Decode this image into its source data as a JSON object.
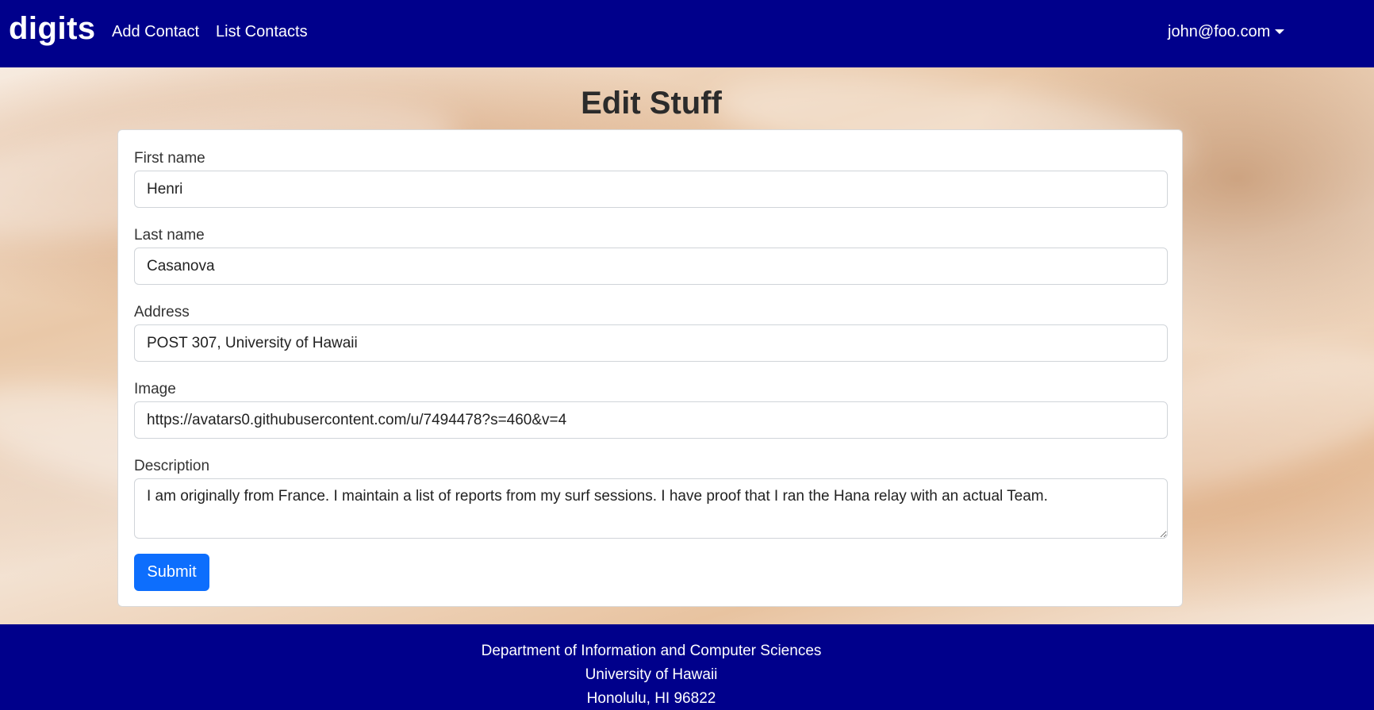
{
  "navbar": {
    "brand": "digits",
    "links": {
      "add_contact": "Add Contact",
      "list_contacts": "List Contacts"
    },
    "user_email": "john@foo.com",
    "background_color": "#00008b"
  },
  "main": {
    "title": "Edit Stuff",
    "form": {
      "first_name": {
        "label": "First name",
        "value": "Henri"
      },
      "last_name": {
        "label": "Last name",
        "value": "Casanova"
      },
      "address": {
        "label": "Address",
        "value": "POST 307, University of Hawaii"
      },
      "image": {
        "label": "Image",
        "value": "https://avatars0.githubusercontent.com/u/7494478?s=460&v=4"
      },
      "description": {
        "label": "Description",
        "value": "I am originally from France. I maintain a list of reports from my surf sessions. I have proof that I ran the Hana relay with an actual Team."
      },
      "submit_label": "Submit",
      "submit_color": "#0d6efd"
    }
  },
  "footer": {
    "lines": [
      "Department of Information and Computer Sciences",
      "University of Hawaii",
      "Honolulu, HI 96822"
    ],
    "background_color": "#00008b"
  }
}
